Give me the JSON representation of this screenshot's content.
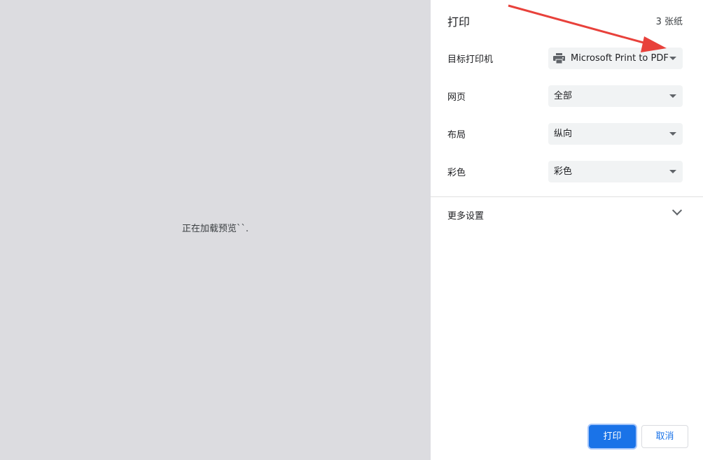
{
  "preview": {
    "loading_text": "正在加载预览``."
  },
  "panel": {
    "title": "打印",
    "sheet_count": "3 张纸",
    "rows": {
      "destination": {
        "label": "目标打印机",
        "value": "Microsoft Print to PDF",
        "icon": "printer-icon"
      },
      "pages": {
        "label": "网页",
        "value": "全部"
      },
      "layout": {
        "label": "布局",
        "value": "纵向"
      },
      "color": {
        "label": "彩色",
        "value": "彩色"
      }
    },
    "more_settings": "更多设置",
    "buttons": {
      "print": "打印",
      "cancel": "取消"
    }
  },
  "colors": {
    "accent": "#1a73e8",
    "preview_bg": "#dcdce0",
    "annotation_arrow": "#e8413b"
  }
}
